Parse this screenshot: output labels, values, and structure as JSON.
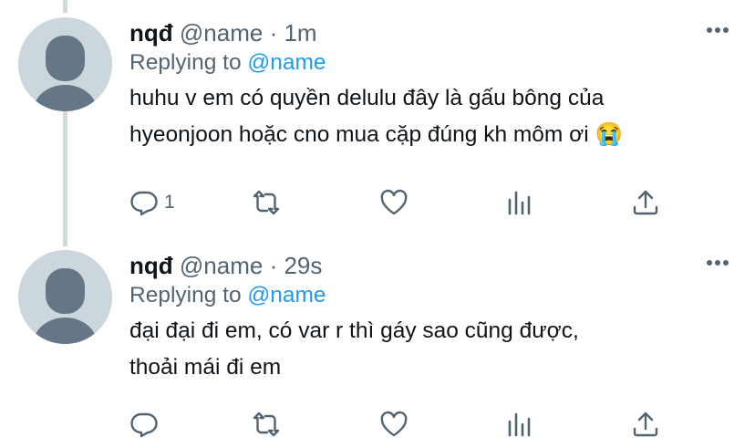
{
  "tweets": [
    {
      "display_name": "nqđ",
      "handle": "@name",
      "separator": "·",
      "time": "1m",
      "replying_prefix": "Replying to",
      "replying_handle": "@name",
      "text_line1": "huhu v em có quyền delulu đây là gấu bông của",
      "text_line2": "hyeonjoon hoặc cno mua cặp đúng kh môm ơi 😭",
      "reply_count": "1"
    },
    {
      "display_name": "nqđ",
      "handle": "@name",
      "separator": "·",
      "time": "29s",
      "replying_prefix": "Replying to",
      "replying_handle": "@name",
      "text_line1": "đại đại đi em, có var r thì gáy sao cũng được,",
      "text_line2": "thoải mái đi em",
      "reply_count": ""
    }
  ],
  "icons": {
    "more": "more-horizontal-icon",
    "reply": "reply-icon",
    "retweet": "retweet-icon",
    "like": "heart-icon",
    "stats": "analytics-icon",
    "share": "share-icon"
  },
  "colors": {
    "link": "#1d9bf0",
    "secondary_text": "#536471",
    "thread_line": "#cfd9de",
    "avatar_bg": "#ccd6dd",
    "avatar_figure": "#657786"
  }
}
